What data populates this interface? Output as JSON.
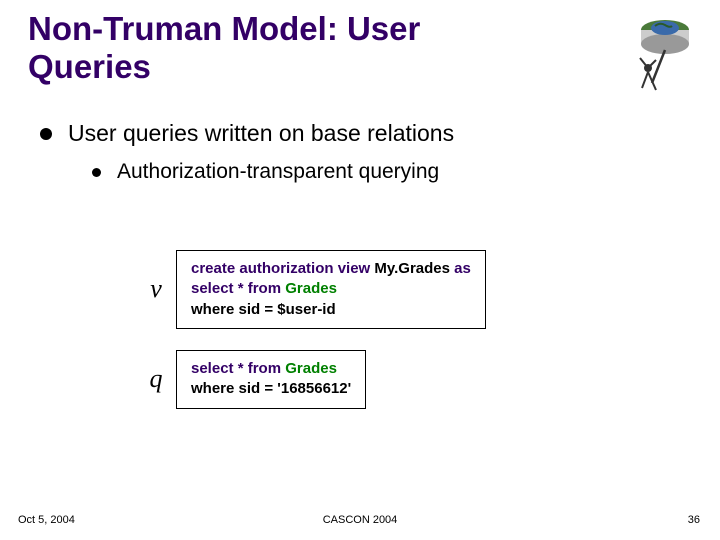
{
  "title": "Non-Truman Model: User Queries",
  "bullet1": "User queries written on base relations",
  "bullet2": "Authorization-transparent querying",
  "blocks": {
    "v": {
      "label": "v",
      "kw_create": "create authorization view",
      "view_name": "My.Grades",
      "kw_as": "as",
      "kw_select": "select * from",
      "table": "Grades",
      "where": "where sid = $user-id"
    },
    "q": {
      "label": "q",
      "kw_select": "select * from",
      "table": "Grades",
      "where": "where sid = '16856612'"
    }
  },
  "footer": {
    "date": "Oct 5, 2004",
    "conf": "CASCON 2004",
    "page": "36"
  }
}
